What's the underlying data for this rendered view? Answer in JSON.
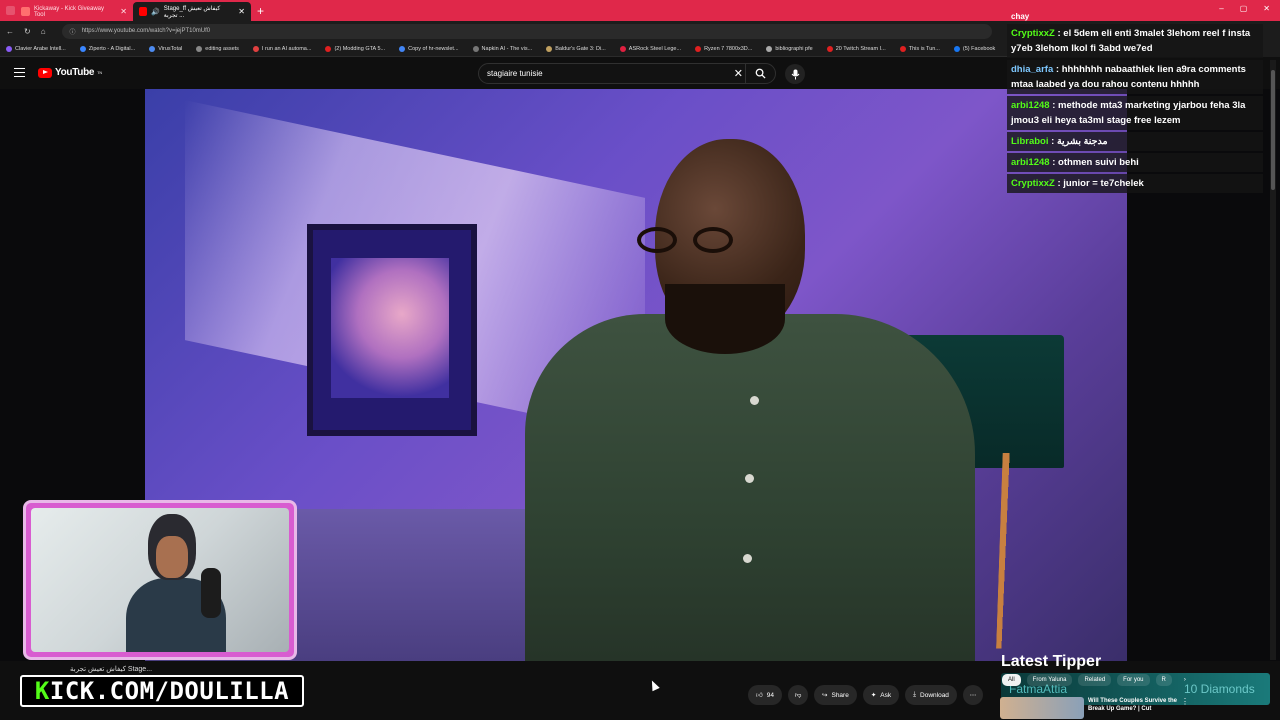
{
  "browser": {
    "tabs": [
      {
        "title": "Kickaway - Kick Giveaway Tool",
        "active": false
      },
      {
        "title": "Stage_ff كيفاش تعيش تجربة ...",
        "active": true
      }
    ],
    "new_tab_symbol": "+",
    "window_controls": [
      "–",
      "▢",
      "✕"
    ],
    "url": "https://www.youtube.com/watch?v=jejPT10mUf0",
    "bookmarks": [
      "Clavier Arabe Intell...",
      "Ziperto - A Digital...",
      "VirusTotal",
      "editing assets",
      "I run an AI automa...",
      "(2) Modding GTA 5...",
      "Copy of hr-newslet...",
      "Napkin AI - The vis...",
      "Baldur's Gate 3: Di...",
      "ASRock Steel Lege...",
      "Ryzen 7 7800x3D...",
      "bibliographi pfe",
      "20 Twitch Stream I...",
      "This is Tun...",
      "(5) Facebook"
    ],
    "bookmark_colors": [
      "#8a5cf6",
      "#3a86ff",
      "#4d8bf0",
      "#888888",
      "#e04040",
      "#e02020",
      "#4285f4",
      "#777777",
      "#c0a060",
      "#e02040",
      "#e02020",
      "#aaaaaa",
      "#e02020",
      "#e02020",
      "#1877f2"
    ]
  },
  "youtube": {
    "logo_text": "YouTube",
    "logo_sup": "TN",
    "search_value": "stagiaire tunisie",
    "actions": {
      "like_count": "94",
      "share": "Share",
      "ask": "Ask",
      "download": "Download"
    },
    "related_tabs": [
      "All",
      "From Yaluna",
      "Related",
      "For you",
      "R"
    ],
    "recommendation": {
      "title_line1": "Will These Couples Survive the",
      "title_line2": "Break Up Game? | Cut"
    }
  },
  "stream": {
    "webcam_caption": "كيفاش تعيش تجربة Stage... ",
    "kick_prefix": "K",
    "kick_rest": "ICK.COM/DOULILLA",
    "tipper_title": "Latest Tipper",
    "tipper_name": "FatmaAttia",
    "tipper_amount": "10 Diamonds"
  },
  "chat": {
    "header": "chay",
    "messages": [
      {
        "user": "CryptixxZ",
        "color": "#53fc18",
        "text": "el 5dem eli enti 3malet 3lehom reel f insta y7eb 3lehom lkol fi 3abd we7ed"
      },
      {
        "user": "dhia_arfa",
        "color": "#7ec8ff",
        "text": "hhhhhhh nabaathlek lien a9ra comments mtaa laabed ya dou rahou contenu hhhhh"
      },
      {
        "user": "arbi1248",
        "color": "#53fc18",
        "text": "methode mta3 marketing yjarbou feha 3la jmou3 eli heya ta3ml stage free lezem"
      },
      {
        "user": "Libraboi",
        "color": "#53fc18",
        "text": "مدجنة بشرية"
      },
      {
        "user": "arbi1248",
        "color": "#53fc18",
        "text": "othmen suivi behi"
      },
      {
        "user": "CryptixxZ",
        "color": "#53fc18",
        "text": "junior = te7chelek"
      }
    ]
  },
  "colors": {
    "tab_strip": "#e0284a",
    "kick_green": "#53fc18",
    "youtube_red": "#ff0000"
  }
}
